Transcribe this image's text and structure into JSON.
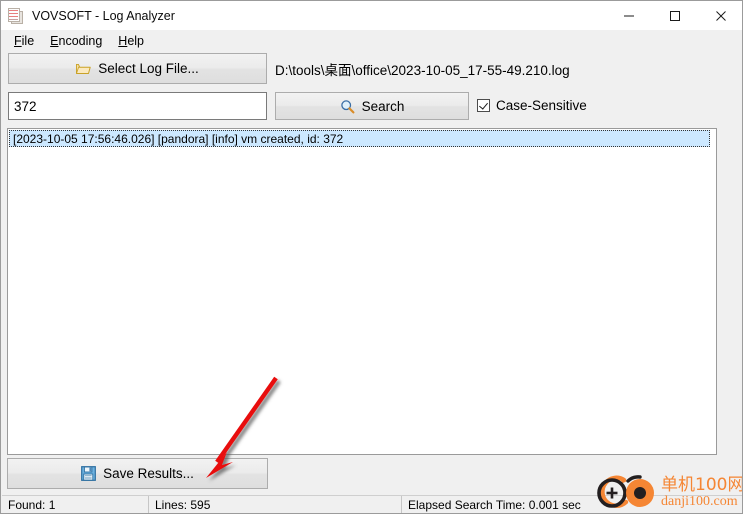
{
  "window": {
    "title": "VOVSOFT - Log Analyzer",
    "icon": "document-lines-icon",
    "controls": {
      "minimize": "minimize-icon",
      "maximize": "maximize-icon",
      "close": "close-icon"
    }
  },
  "menu": {
    "items": [
      {
        "accesskey": "F",
        "rest": "ile"
      },
      {
        "accesskey": "E",
        "rest": "ncoding"
      },
      {
        "accesskey": "H",
        "rest": "elp"
      }
    ]
  },
  "toolbar": {
    "select_log_file_label": "Select Log File...",
    "select_log_file_icon": "open-folder-icon",
    "log_file_path": "D:\\tools\\桌面\\office\\2023-10-05_17-55-49.210.log"
  },
  "search": {
    "query": "372",
    "placeholder": "",
    "button_label": "Search",
    "button_icon": "magnifier-icon",
    "case_sensitive_label": "Case-Sensitive",
    "case_sensitive_checked": true
  },
  "results": {
    "rows": [
      "[2023-10-05 17:56:46.026] [pandora] [info] vm created, id: 372"
    ],
    "selected_index": 0
  },
  "save": {
    "label": "Save Results...",
    "icon": "floppy-disk-icon"
  },
  "status": {
    "found": "Found: 1",
    "lines": "Lines: 595",
    "elapsed": "Elapsed Search Time: 0.001 sec"
  },
  "annotation": {
    "arrow_color": "#e81010",
    "arrow_target": "save-results-button"
  },
  "watermark": {
    "cn_text": "单机100网",
    "url_text": "danji100.com",
    "color": "#f58634"
  }
}
